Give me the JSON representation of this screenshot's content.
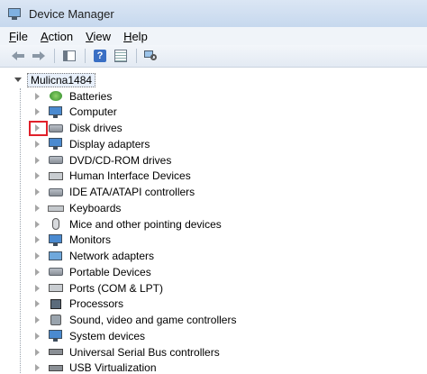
{
  "window": {
    "title": "Device Manager"
  },
  "menu": [
    {
      "label": "File",
      "accel": "F",
      "rest": "ile"
    },
    {
      "label": "Action",
      "accel": "A",
      "rest": "ction"
    },
    {
      "label": "View",
      "accel": "V",
      "rest": "iew"
    },
    {
      "label": "Help",
      "accel": "H",
      "rest": "elp"
    }
  ],
  "toolbar": {
    "buttons": [
      "back-icon",
      "forward-icon",
      "show-hide-console-tree-icon",
      "help-icon",
      "properties-icon",
      "scan-hardware-icon"
    ]
  },
  "tree": {
    "root": "Mulicna1484",
    "items": [
      {
        "label": "Batteries",
        "icon": "battery-icon"
      },
      {
        "label": "Computer",
        "icon": "computer-icon"
      },
      {
        "label": "Disk drives",
        "icon": "disk-drive-icon"
      },
      {
        "label": "Display adapters",
        "icon": "display-adapter-icon"
      },
      {
        "label": "DVD/CD-ROM drives",
        "icon": "dvd-drive-icon"
      },
      {
        "label": "Human Interface Devices",
        "icon": "hid-icon"
      },
      {
        "label": "IDE ATA/ATAPI controllers",
        "icon": "ide-controller-icon"
      },
      {
        "label": "Keyboards",
        "icon": "keyboard-icon"
      },
      {
        "label": "Mice and other pointing devices",
        "icon": "mouse-icon"
      },
      {
        "label": "Monitors",
        "icon": "monitor-icon"
      },
      {
        "label": "Network adapters",
        "icon": "network-adapter-icon"
      },
      {
        "label": "Portable Devices",
        "icon": "portable-device-icon"
      },
      {
        "label": "Ports (COM & LPT)",
        "icon": "port-icon"
      },
      {
        "label": "Processors",
        "icon": "processor-icon"
      },
      {
        "label": "Sound, video and game controllers",
        "icon": "sound-icon"
      },
      {
        "label": "System devices",
        "icon": "system-device-icon"
      },
      {
        "label": "Universal Serial Bus controllers",
        "icon": "usb-icon"
      },
      {
        "label": "USB Virtualization",
        "icon": "usb-virtualization-icon"
      }
    ]
  },
  "colors": {
    "highlight": "#e0202a",
    "titlebar": "#c6d8ee"
  }
}
